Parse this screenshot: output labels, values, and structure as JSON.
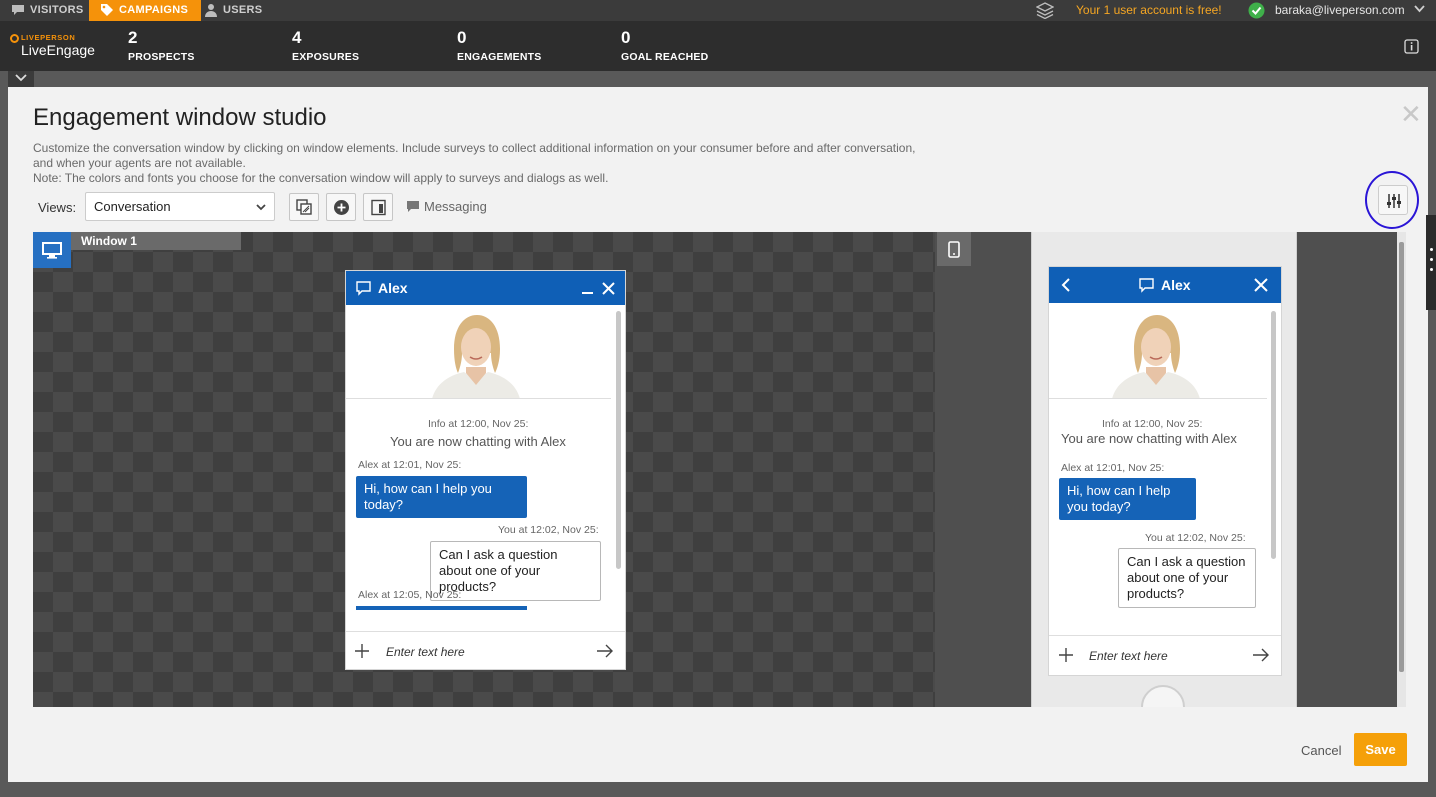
{
  "topnav": {
    "visitors": "VISITORS",
    "campaigns": "CAMPAIGNS",
    "users": "USERS",
    "free_note": "Your 1 user account is free!",
    "user_email": "baraka@liveperson.com"
  },
  "brand": {
    "small": "LIVEPERSON",
    "main": "LiveEngage"
  },
  "stats": [
    {
      "value": "2",
      "label": "PROSPECTS"
    },
    {
      "value": "4",
      "label": "EXPOSURES"
    },
    {
      "value": "0",
      "label": "ENGAGEMENTS"
    },
    {
      "value": "0",
      "label": "GOAL REACHED"
    }
  ],
  "studio": {
    "title": "Engagement window studio",
    "desc_line1": "Customize the conversation window by clicking on window elements. Include surveys to collect additional information on your consumer before and after conversation,",
    "desc_line2": "and when your agents are not available.",
    "desc_line3": "Note: The colors and fonts you choose for the conversation window will apply to surveys and dialogs as well.",
    "views_label": "Views:",
    "views_value": "Conversation",
    "messaging": "Messaging",
    "window_label": "Window 1"
  },
  "chat": {
    "agent_name": "Alex",
    "info_meta": "Info at 12:00, Nov 25:",
    "system_msg": "You are now chatting with Alex",
    "agent_meta1": "Alex at 12:01, Nov 25:",
    "agent_msg1": "Hi, how can I help you today?",
    "user_meta": "You at 12:02, Nov 25:",
    "user_msg": "Can I ask a question about one of your products?",
    "agent_meta2": "Alex at 12:05, Nov 25:",
    "input_placeholder": "Enter text here"
  },
  "footer": {
    "cancel": "Cancel",
    "save": "Save"
  },
  "colors": {
    "accent_orange": "#f5920a",
    "chat_blue": "#0f5fb6",
    "highlight_ring": "#2a15d6"
  }
}
